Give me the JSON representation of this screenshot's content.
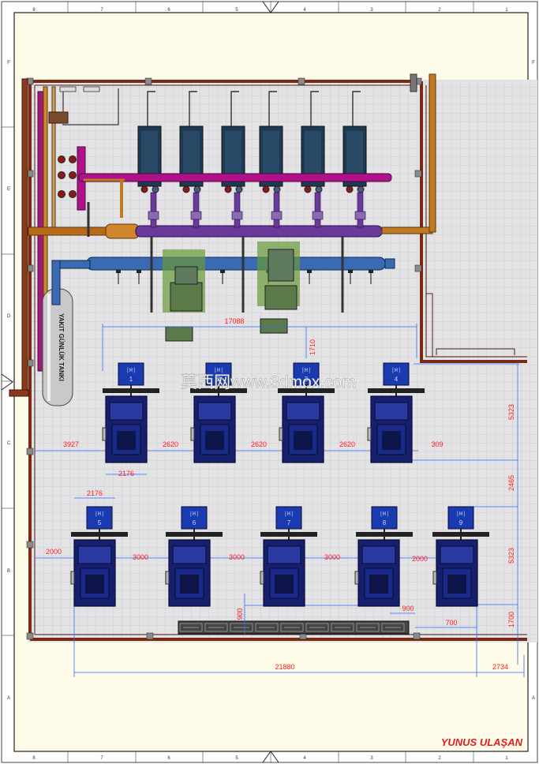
{
  "drawing": {
    "author": "YUNUS ULAŞAN",
    "watermark": "莫西网www.3dmox.com",
    "frame_cols_top": [
      "8",
      "7",
      "6",
      "5",
      "4",
      "3",
      "2",
      "1"
    ],
    "frame_rows_left": [
      "F",
      "E",
      "D",
      "C",
      "B",
      "A"
    ],
    "tank_label": "YAKIT GÜNLÜK TANKI",
    "colors": {
      "dimension": "#ff2020",
      "dimension_line": "#2a6cff",
      "boiler": "#1a2a9a",
      "wall": "#8a2a1a",
      "floor": "#e6e6e6",
      "pipe_magenta": "#b0108a",
      "pipe_purple": "#6a3a9a",
      "pipe_blue": "#3a6ab0",
      "pipe_orange": "#c07a20"
    }
  },
  "boilers_row1": [
    {
      "label": "1"
    },
    {
      "label": "2"
    },
    {
      "label": "3"
    },
    {
      "label": "4"
    }
  ],
  "boilers_row2": [
    {
      "label": "5"
    },
    {
      "label": "6"
    },
    {
      "label": "7"
    },
    {
      "label": "8"
    },
    {
      "label": "9"
    }
  ],
  "dims": {
    "d17088": "17088",
    "d1710": "1710",
    "d3927": "3927",
    "d2620a": "2620",
    "d2620b": "2620",
    "d2620c": "2620",
    "d309": "309",
    "d2176a": "2176",
    "d2176b": "2176",
    "d5323a": "5323",
    "d2465": "2465",
    "d5323b": "5323",
    "d2000a": "2000",
    "d3000a": "3000",
    "d3000b": "3000",
    "d3000c": "3000",
    "d2000b": "2000",
    "d900a": "900",
    "d900b": "900",
    "d700": "700",
    "d1700": "1700",
    "d21880": "21880",
    "d2734": "2734"
  }
}
